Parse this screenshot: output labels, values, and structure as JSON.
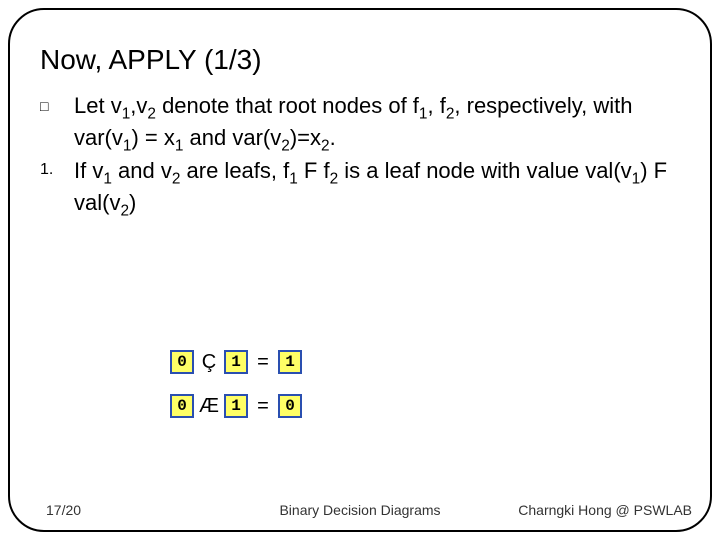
{
  "title": "Now, APPLY (1/3)",
  "bullets": [
    {
      "marker": "□",
      "t1": "Let v",
      "s1": "1",
      "t2": ",v",
      "s2": "2",
      "t3": " denote that root nodes of f",
      "s3": "1",
      "t4": ", f",
      "s4": "2",
      "t5": ", respectively, with var(v",
      "s5": "1",
      "t6": ") = x",
      "s6": "1",
      "t7": " and var(v",
      "s7": "2",
      "t8": ")=x",
      "s8": "2",
      "t9": "."
    },
    {
      "marker": "1.",
      "t1": "If v",
      "s1": "1",
      "t2": " and v",
      "s2": "2",
      "t3": " are leafs, f",
      "s3": "1",
      "t4": " F f",
      "s4": "2",
      "t5": " is a leaf node with value val(v",
      "s5": "1",
      "t6": ") F val(v",
      "s6": "2",
      "t7": ")"
    }
  ],
  "rows": [
    {
      "a": "0",
      "op": "Ç",
      "b": "1",
      "eq": "=",
      "c": "1"
    },
    {
      "a": "0",
      "op": "Æ",
      "b": "1",
      "eq": "=",
      "c": "0"
    }
  ],
  "footer": {
    "left": "17/20",
    "center": "Binary Decision Diagrams",
    "right": "Charngki Hong @ PSWLAB"
  }
}
